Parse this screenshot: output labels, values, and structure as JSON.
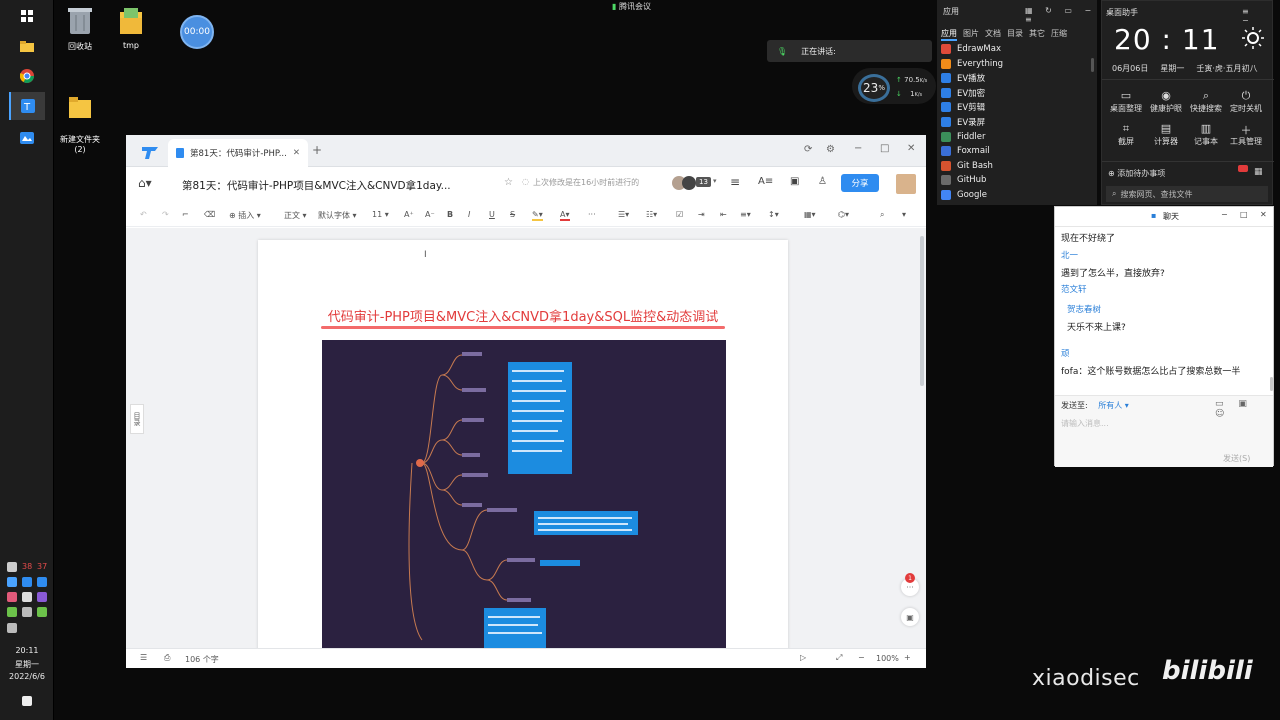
{
  "desktop": {
    "icons": [
      {
        "label": "回收站"
      },
      {
        "label": "tmp"
      },
      {
        "label": "新建文件夹\n(2)"
      }
    ],
    "timer_badge": "00:00"
  },
  "taskbar": {
    "time": "20:11",
    "weekday": "星期一",
    "date": "2022/6/6",
    "tray_numbers": [
      "38",
      "37"
    ]
  },
  "meeting": {
    "app_name": "腾讯会议",
    "speaking_label": "正在讲话:"
  },
  "sysmon": {
    "cpu_percent": "23",
    "cpu_unit": "%",
    "up_speed": "70.5",
    "up_unit": "K/s",
    "down_speed": "1",
    "down_unit": "K/s"
  },
  "launcher": {
    "title": "应用",
    "tabs": [
      "应用",
      "图片",
      "文档",
      "目录",
      "其它",
      "压缩"
    ],
    "apps": [
      {
        "name": "EdrawMax",
        "color": "#e04b3a"
      },
      {
        "name": "Everything",
        "color": "#f08c1a"
      },
      {
        "name": "EV播放",
        "color": "#2e7fe6"
      },
      {
        "name": "EV加密",
        "color": "#2e7fe6"
      },
      {
        "name": "EV剪辑",
        "color": "#2e7fe6"
      },
      {
        "name": "EV录屏",
        "color": "#2e7fe6"
      },
      {
        "name": "Fiddler",
        "color": "#3b8f5a"
      },
      {
        "name": "Foxmail",
        "color": "#3a6fd8"
      },
      {
        "name": "Git Bash",
        "color": "#d6532f"
      },
      {
        "name": "GitHub",
        "color": "#6b6b6b"
      },
      {
        "name": "Google",
        "color": "#4285f4"
      }
    ]
  },
  "assistant": {
    "title": "桌面助手",
    "hour": "20",
    "minute": "11",
    "date": "06月06日",
    "weekday": "星期一",
    "lunar": "壬寅·虎·五月初八",
    "tools_row1": [
      "桌面整理",
      "健康护眼",
      "快捷搜索",
      "定时关机"
    ],
    "tools_row2": [
      "截屏",
      "计算器",
      "记事本",
      "工具管理"
    ],
    "todo": "添加待办事项",
    "search_placeholder": "搜索网页、查找文件"
  },
  "chat": {
    "title": "聊天",
    "messages": [
      {
        "name": "",
        "text": "现在不好绕了"
      },
      {
        "name": "北一",
        "text": "遇到了怎么半，直接放弃?"
      },
      {
        "name": "范文轩",
        "text": ""
      },
      {
        "name": "贺志春树",
        "text": "天乐不来上课?"
      },
      {
        "name": "顽",
        "text": "fofa：这个账号数据怎么比占了搜索总数一半"
      }
    ],
    "send_to_label": "发送至:",
    "send_to_value": "所有人",
    "input_placeholder": "请输入消息...",
    "send_button": "发送(S)"
  },
  "doc": {
    "tab_title": "第81天：代码审计-PHP...",
    "doc_title_bar": "第81天：代码审计-PHP项目&MVC注入&CNVD拿1day...",
    "save_status": "上次修改是在16小时前进行的",
    "collab_count": "13",
    "share_button": "分享",
    "toolbar": {
      "insert": "插入",
      "style": "正文",
      "font": "默认字体",
      "size": "11"
    },
    "heading": "代码审计-PHP项目&MVC注入&CNVD拿1day&SQL监控&动态调试",
    "side_outline": "目录",
    "word_count": "106 个字",
    "zoom": "100%",
    "notif_count": "1"
  },
  "branding": {
    "watermark": "xiaodisec",
    "logo": "bilibili"
  }
}
